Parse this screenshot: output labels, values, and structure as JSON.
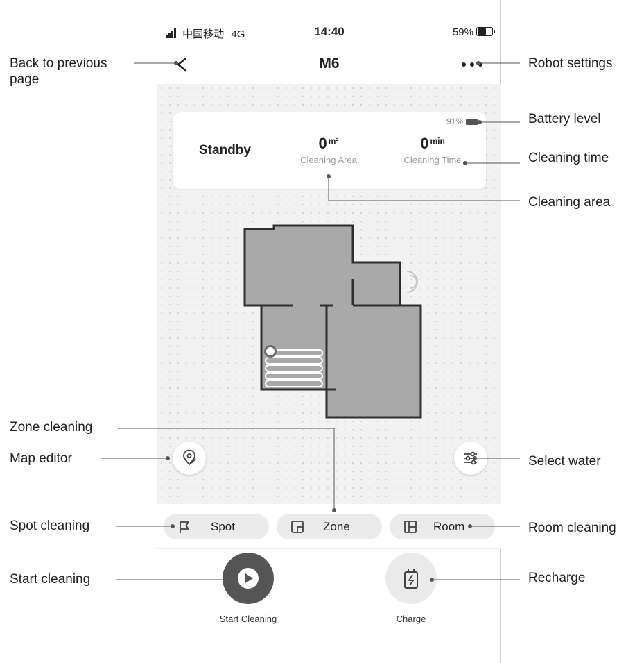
{
  "status_bar": {
    "carrier": "中国移动",
    "network": "4G",
    "time": "14:40",
    "battery": "59%"
  },
  "nav": {
    "title": "M6"
  },
  "status_card": {
    "battery": "91%",
    "state": "Standby",
    "area_value": "0",
    "area_unit": "m²",
    "area_label": "Cleaning Area",
    "time_value": "0",
    "time_unit": "min",
    "time_label": "Cleaning Time"
  },
  "modes": {
    "spot": "Spot",
    "zone": "Zone",
    "room": "Room"
  },
  "actions": {
    "start": "Start Cleaning",
    "charge": "Charge"
  },
  "callouts": {
    "back": "Back to previous page",
    "settings": "Robot settings",
    "battery": "Battery level",
    "cleaning_time": "Cleaning time",
    "cleaning_area": "Cleaning area",
    "zone_cleaning": "Zone cleaning",
    "map_editor": "Map editor",
    "select_water": "Select water",
    "spot_cleaning": "Spot cleaning",
    "room_cleaning": "Room cleaning",
    "start_cleaning": "Start cleaning",
    "recharge": "Recharge"
  },
  "colors": {
    "map_floor": "#a9a9a9",
    "map_wall": "#2f2f2f",
    "start_button": "#555555",
    "charge_button": "#ebebeb",
    "mode_button": "#ebebeb"
  },
  "icons": {
    "back": "chevron-left-icon",
    "settings": "more-dots-icon",
    "map_editor": "map-pin-edit-icon",
    "water": "sliders-icon",
    "spot": "flag-icon",
    "zone": "zone-square-icon",
    "room": "room-grid-icon",
    "start": "play-icon",
    "charge": "battery-charge-icon"
  }
}
